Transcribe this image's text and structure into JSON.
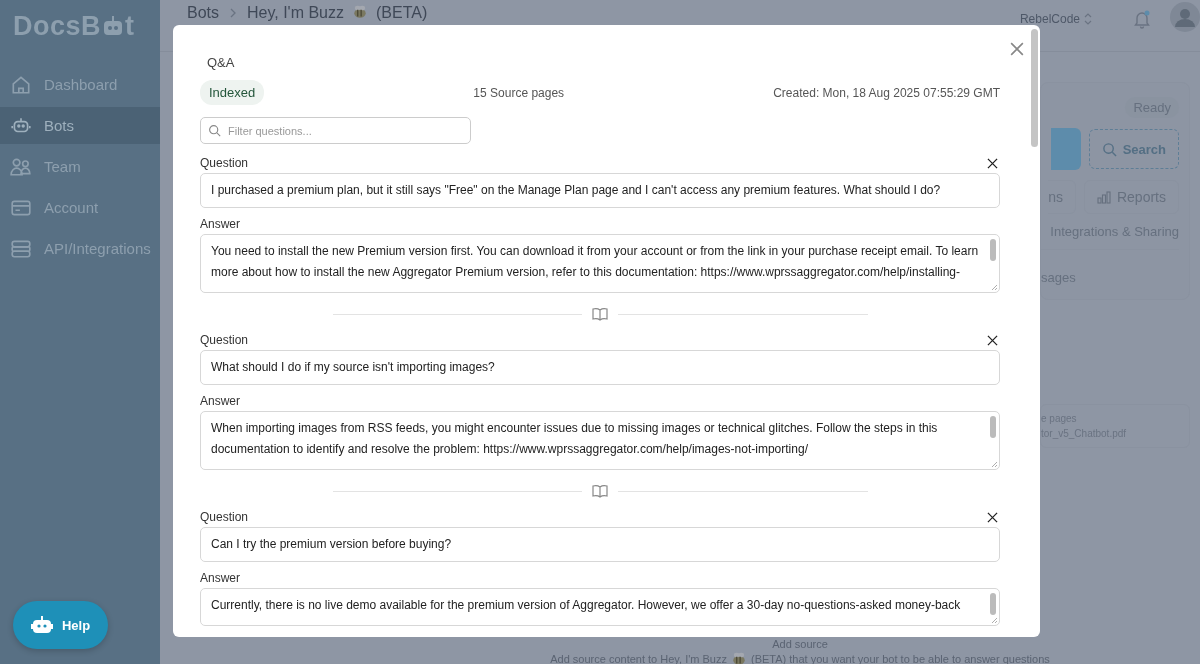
{
  "sidebar": {
    "logo_start": "DocsB",
    "logo_end": "t",
    "items": [
      {
        "label": "Dashboard",
        "selected": false
      },
      {
        "label": "Bots",
        "selected": true
      },
      {
        "label": "Team",
        "selected": false
      },
      {
        "label": "Account",
        "selected": false
      },
      {
        "label": "API/Integrations",
        "selected": false
      }
    ]
  },
  "header": {
    "crumb_parent": "Bots",
    "crumb_current": "Hey, I'm Buzz",
    "crumb_suffix": "(BETA)",
    "team": "RebelCode"
  },
  "bot_panel": {
    "status": "Ready",
    "search_button": "Search",
    "buttons": [
      "ns",
      "Reports"
    ],
    "link": "Integrations & Sharing",
    "section": "sages"
  },
  "sources_card": {
    "lines": [
      "e pages",
      "tor_v5_Chatbot.pdf"
    ]
  },
  "add_source": {
    "title": "Add source",
    "description_start": "Add source content to Hey, I'm Buzz",
    "description_end": "(BETA) that you want your bot to be able to answer questions"
  },
  "help_button": "Help",
  "modal": {
    "title": "Q&A",
    "status": "Indexed",
    "pages": "15 Source pages",
    "created": "Created: Mon, 18 Aug 2025 07:55:29 GMT",
    "filter_placeholder": "Filter questions...",
    "pairs": [
      {
        "question_label": "Question",
        "question": "I purchased a premium plan, but it still says \"Free\" on the Manage Plan page and I can't access any premium features. What should I do?",
        "answer_label": "Answer",
        "answer": "You need to install the new Premium version first. You can download it from your account or from the link in your purchase receipt email. To learn more about how to install the new Aggregator Premium version, refer to this documentation: https://www.wprssaggregator.com/help/installing-"
      },
      {
        "question_label": "Question",
        "question": "What should I do if my source isn't importing images?",
        "answer_label": "Answer",
        "answer": "When importing images from RSS feeds, you might encounter issues due to missing images or technical glitches. Follow the steps in this documentation to identify and resolve the problem: https://www.wprssaggregator.com/help/images-not-importing/"
      },
      {
        "question_label": "Question",
        "question": "Can I try the premium version before buying?",
        "answer_label": "Answer",
        "answer": "Currently, there is no live demo available for the premium version of Aggregator. However, we offer a 30-day no-questions-asked money-back"
      }
    ]
  }
}
